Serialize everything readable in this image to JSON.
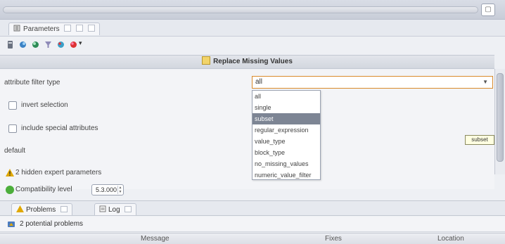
{
  "tabs": {
    "parameters_label": "Parameters"
  },
  "panel": {
    "title": "Replace Missing Values"
  },
  "params": {
    "attribute_filter_type_label": "attribute filter type",
    "invert_selection_label": "invert selection",
    "include_special_label": "include special attributes",
    "default_label": "default",
    "hidden_expert_label": "2 hidden expert parameters",
    "compatibility_label": "Compatibility level",
    "compatibility_value": "5.3.000"
  },
  "combo": {
    "selected": "all",
    "options": [
      "all",
      "single",
      "subset",
      "regular_expression",
      "value_type",
      "block_type",
      "no_missing_values",
      "numeric_value_filter"
    ],
    "highlighted": "subset",
    "tooltip": "subset"
  },
  "problems": {
    "problems_tab": "Problems",
    "log_tab": "Log",
    "summary": "2 potential problems",
    "columns": [
      "Message",
      "Fixes",
      "Location"
    ]
  },
  "colors": {
    "accent": "#d98a2b",
    "selection": "#7d8594",
    "ok": "#4cae3b",
    "warning": "#e0a800"
  }
}
